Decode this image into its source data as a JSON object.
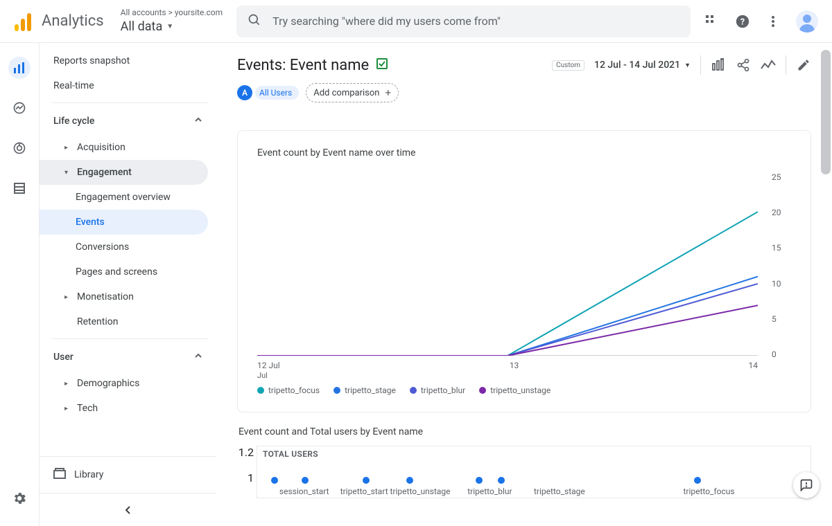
{
  "app_name": "Analytics",
  "breadcrumb_top": "All accounts > yoursite.com",
  "breadcrumb_main": "All data",
  "search_placeholder": "Try searching \"where did my users come from\"",
  "nav": {
    "top": [
      "Reports snapshot",
      "Real-time"
    ],
    "life_cycle": "Life cycle",
    "acquisition": "Acquisition",
    "engagement": "Engagement",
    "engagement_children": [
      "Engagement overview",
      "Events",
      "Conversions",
      "Pages and screens"
    ],
    "monetisation": "Monetisation",
    "retention": "Retention",
    "user": "User",
    "demographics": "Demographics",
    "tech": "Tech",
    "library": "Library"
  },
  "page_title": "Events: Event name",
  "date_label": "Custom",
  "date_range": "12 Jul - 14 Jul 2021",
  "segment_label": "All Users",
  "add_comparison": "Add comparison",
  "chart_data": {
    "type": "line",
    "title": "Event count by Event name over time",
    "xlabel": "",
    "ylabel": "",
    "x": [
      "12 Jul",
      "13",
      "14"
    ],
    "y_ticks": [
      0,
      5,
      10,
      15,
      20,
      25
    ],
    "ylim": [
      0,
      25
    ],
    "series": [
      {
        "name": "tripetto_focus",
        "color": "#12a4b4",
        "values": [
          0,
          0,
          20
        ]
      },
      {
        "name": "tripetto_stage",
        "color": "#2374e1",
        "values": [
          0,
          0,
          11
        ]
      },
      {
        "name": "tripetto_blur",
        "color": "#4f5bd5",
        "values": [
          0,
          0,
          10
        ]
      },
      {
        "name": "tripetto_unstage",
        "color": "#7b28a8",
        "values": [
          0,
          0,
          7
        ]
      }
    ]
  },
  "scatter": {
    "title": "Event count and Total users by Event name",
    "header": "TOTAL USERS",
    "y_ticks": [
      "1.2",
      "1"
    ],
    "points": [
      {
        "label": "session_start",
        "x_pct": 4,
        "dot_pct": 2.5
      },
      {
        "label": "",
        "x_pct": null,
        "dot_pct": 8
      },
      {
        "label": "tripetto_start",
        "x_pct": 15,
        "dot_pct": 19
      },
      {
        "label": "tripetto_unstage",
        "x_pct": 24,
        "dot_pct": 27
      },
      {
        "label": "tripetto_blur",
        "x_pct": 38,
        "dot_pct": 39.5
      },
      {
        "label": "",
        "x_pct": null,
        "dot_pct": 43.5
      },
      {
        "label": "tripetto_stage",
        "x_pct": 50,
        "dot_pct": null
      },
      {
        "label": "tripetto_focus",
        "x_pct": 77,
        "dot_pct": 79
      }
    ]
  }
}
